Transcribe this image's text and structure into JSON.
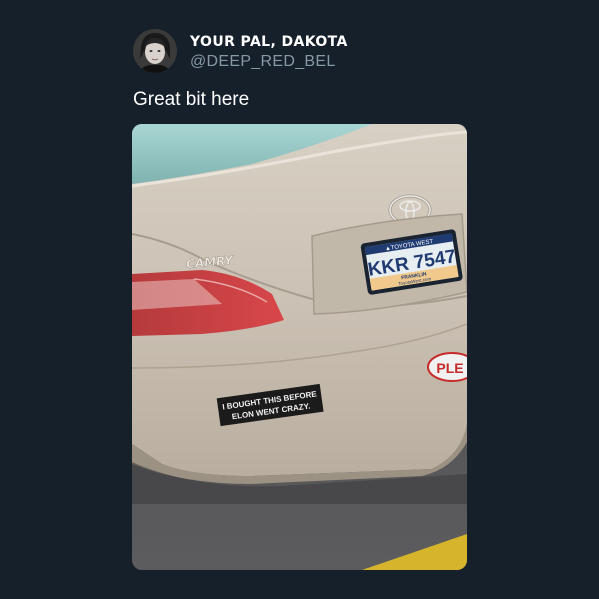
{
  "tweet": {
    "author_name": "YOUR PAL, DAKOTA",
    "author_handle": "@DEEP_RED_BEL",
    "text": "Great bit here"
  },
  "photo": {
    "car_model_badge": "CAMRY",
    "plate_dealer": "▲TOYOTA WEST",
    "plate_number": "KKR 7547",
    "plate_county": "FRANKLIN",
    "plate_site": "ToyotaWest.com",
    "sticker_line1": "I BOUGHT THIS BEFORE",
    "sticker_line2": "ELON WENT CRAZY.",
    "partial_sticker": "PLE"
  },
  "colors": {
    "background": "#15202b",
    "name": "#ffffff",
    "handle": "#8899a6",
    "car_paint": "#cbc1b4"
  }
}
